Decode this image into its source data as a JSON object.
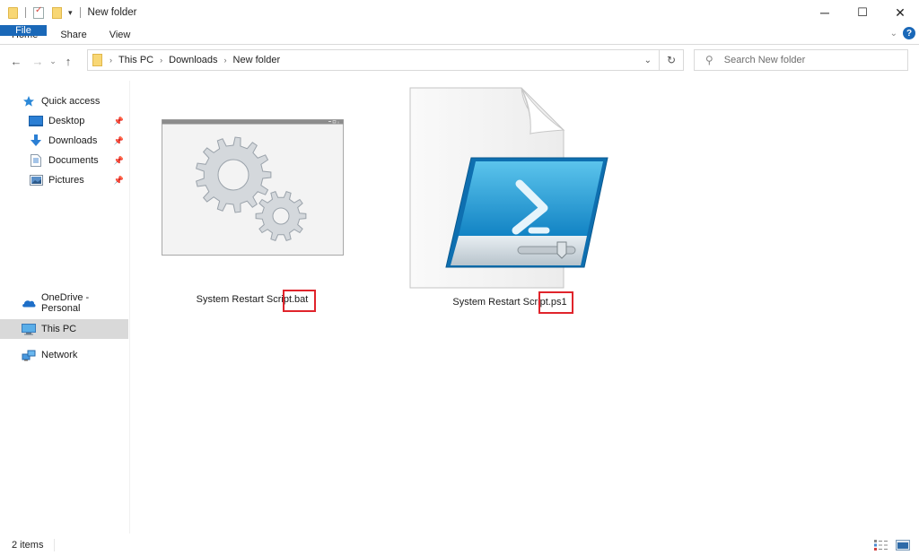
{
  "window": {
    "title": "New folder",
    "controls": {
      "minimize": "─",
      "maximize": "☐",
      "close": "✕"
    }
  },
  "ribbon": {
    "tabs": [
      {
        "label": "File",
        "active": true
      },
      {
        "label": "Home"
      },
      {
        "label": "Share"
      },
      {
        "label": "View"
      }
    ],
    "expand_glyph": "⌄",
    "help_glyph": "?",
    "accent": "#1a68b8"
  },
  "navigation": {
    "back": "←",
    "forward": "→",
    "recent": "⌄",
    "up": "↑",
    "breadcrumb": [
      "This PC",
      "Downloads",
      "New folder"
    ],
    "crumb_separator": "›",
    "address_dropdown": "⌄",
    "refresh": "↻",
    "search": {
      "placeholder": "Search New folder",
      "value": ""
    }
  },
  "sidebar": {
    "quick_access": {
      "label": "Quick access",
      "icon": "star-icon"
    },
    "pinned": [
      {
        "label": "Desktop",
        "icon": "desktop-icon",
        "pinned": true
      },
      {
        "label": "Downloads",
        "icon": "download-icon",
        "pinned": true
      },
      {
        "label": "Documents",
        "icon": "documents-icon",
        "pinned": true
      },
      {
        "label": "Pictures",
        "icon": "pictures-icon",
        "pinned": true
      }
    ],
    "roots": [
      {
        "label": "OneDrive - Personal",
        "icon": "cloud-icon"
      },
      {
        "label": "This PC",
        "icon": "computer-icon",
        "selected": true
      },
      {
        "label": "Network",
        "icon": "network-icon"
      }
    ],
    "pin_glyph": "📌"
  },
  "files": [
    {
      "name": "System Restart Script.bat",
      "type": "batch-file",
      "highlighted_extension": ".bat"
    },
    {
      "name": "System Restart Script.ps1",
      "type": "powershell-script",
      "highlighted_extension": ".ps1"
    }
  ],
  "annotations": {
    "highlight_color": "#e0242b"
  },
  "status": {
    "item_count": "2 items"
  }
}
